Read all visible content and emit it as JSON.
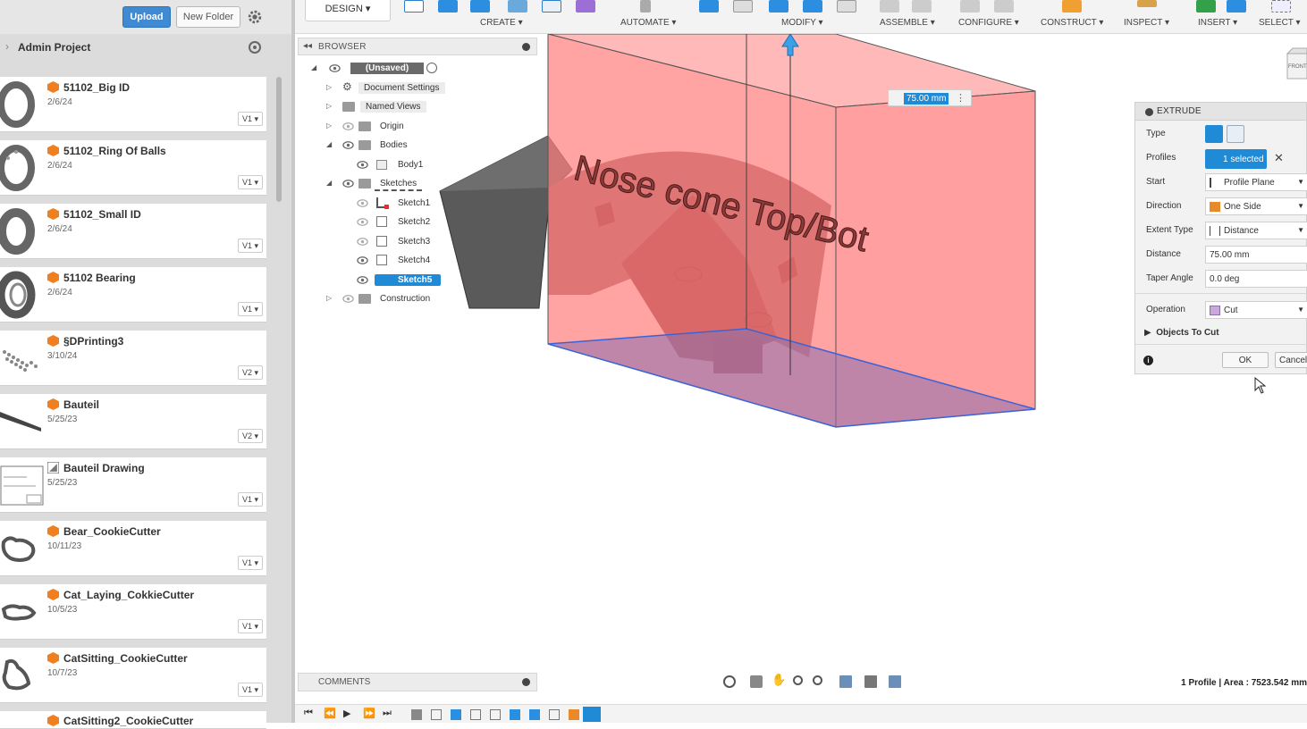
{
  "left_panel": {
    "upload_label": "Upload",
    "new_folder_label": "New Folder",
    "project_name": "Admin Project",
    "files": [
      {
        "name": "51102_Big ID",
        "date": "2/6/24",
        "version": "V1 ▾",
        "kind": "part",
        "thumb": "ring"
      },
      {
        "name": "51102_Ring Of Balls",
        "date": "2/6/24",
        "version": "V1 ▾",
        "kind": "part",
        "thumb": "ring"
      },
      {
        "name": "51102_Small ID",
        "date": "2/6/24",
        "version": "V1 ▾",
        "kind": "part",
        "thumb": "ring"
      },
      {
        "name": "51102 Bearing",
        "date": "2/6/24",
        "version": "V1 ▾",
        "kind": "part",
        "thumb": "bearing"
      },
      {
        "name": "§DPrinting3",
        "date": "3/10/24",
        "version": "V2 ▾",
        "kind": "part",
        "thumb": "dots"
      },
      {
        "name": "Bauteil",
        "date": "5/25/23",
        "version": "V2 ▾",
        "kind": "part",
        "thumb": "bar"
      },
      {
        "name": "Bauteil Drawing",
        "date": "5/25/23",
        "version": "V1 ▾",
        "kind": "drawing",
        "thumb": "drawing"
      },
      {
        "name": "Bear_CookieCutter",
        "date": "10/11/23",
        "version": "V1 ▾",
        "kind": "part",
        "thumb": "cutter"
      },
      {
        "name": "Cat_Laying_CokkieCutter",
        "date": "10/5/23",
        "version": "V1 ▾",
        "kind": "part",
        "thumb": "cutter"
      },
      {
        "name": "CatSitting_CookieCutter",
        "date": "10/7/23",
        "version": "V1 ▾",
        "kind": "part",
        "thumb": "cutter"
      }
    ],
    "partial_next_file": "CatSitting2_CookieCutter"
  },
  "toolbar": {
    "design_label": "DESIGN ▾",
    "groups": [
      {
        "label": "CREATE ▾"
      },
      {
        "label": "AUTOMATE ▾"
      },
      {
        "label": "MODIFY ▾"
      },
      {
        "label": "ASSEMBLE ▾"
      },
      {
        "label": "CONFIGURE ▾"
      },
      {
        "label": "CONSTRUCT ▾"
      },
      {
        "label": "INSPECT ▾"
      },
      {
        "label": "INSERT ▾"
      },
      {
        "label": "SELECT ▾"
      }
    ]
  },
  "browser": {
    "title": "BROWSER",
    "root": "(Unsaved)",
    "nodes": [
      {
        "label": "Document Settings"
      },
      {
        "label": "Named Views"
      },
      {
        "label": "Origin"
      },
      {
        "label": "Bodies"
      },
      {
        "label": "Body1"
      },
      {
        "label": "Sketches"
      },
      {
        "label": "Sketch1"
      },
      {
        "label": "Sketch2"
      },
      {
        "label": "Sketch3"
      },
      {
        "label": "Sketch4"
      },
      {
        "label": "Sketch5"
      },
      {
        "label": "Construction"
      }
    ]
  },
  "model": {
    "embossed_text": "Nose cone Top/Bot",
    "distance_label": "75.00 mm"
  },
  "extrude": {
    "title": "EXTRUDE",
    "rows": {
      "type_label": "Type",
      "profiles_label": "Profiles",
      "profiles_value": "1 selected",
      "start_label": "Start",
      "start_value": "Profile Plane",
      "direction_label": "Direction",
      "direction_value": "One Side",
      "extent_label": "Extent Type",
      "extent_value": "Distance",
      "distance_label": "Distance",
      "distance_value": "75.00 mm",
      "taper_label": "Taper Angle",
      "taper_value": "0.0 deg",
      "operation_label": "Operation",
      "operation_value": "Cut"
    },
    "objects_to_cut": "Objects To Cut",
    "ok_label": "OK",
    "cancel_label": "Cancel"
  },
  "comments_label": "COMMENTS",
  "status_text": "1 Profile | Area : 7523.542 mm",
  "viewcube_label": "FRONT",
  "colors": {
    "accent": "#1f8ad6",
    "upload": "#3f8ad2",
    "cut_red": "#ff7f7f",
    "body_grey": "#5c5c5c",
    "part_orange": "#f07f1f"
  }
}
